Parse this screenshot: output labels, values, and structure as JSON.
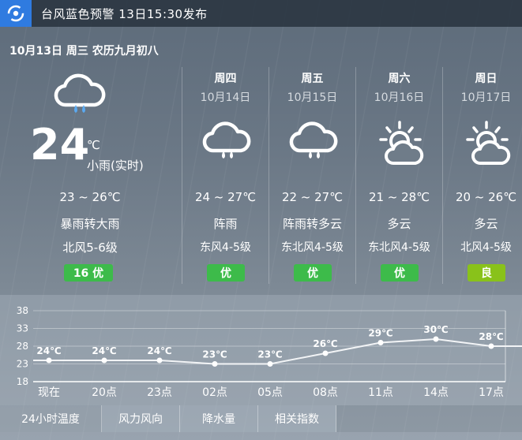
{
  "alert": {
    "icon": "typhoon-icon",
    "text": "台风蓝色预警 13日15:30发布",
    "color": "#2f7be0"
  },
  "date_line": "10月13日 周三 农历九月初八",
  "today": {
    "icon": "cloud-rain-icon",
    "temp": "24",
    "unit": "℃",
    "desc": "小雨(实时)",
    "range": "23 ~ 26℃",
    "condition": "暴雨转大雨",
    "wind": "北风5-6级",
    "aqi": "16 优",
    "aqi_color": "#3dbb4a"
  },
  "days": [
    {
      "week": "周四",
      "date": "10月14日",
      "icon": "cloud-rain-icon",
      "range": "24 ~ 27℃",
      "condition": "阵雨",
      "wind": "东风4-5级",
      "aqi": "优",
      "aqi_color": "#3dbb4a"
    },
    {
      "week": "周五",
      "date": "10月15日",
      "icon": "cloud-rain-icon",
      "range": "22 ~ 27℃",
      "condition": "阵雨转多云",
      "wind": "东北风4-5级",
      "aqi": "优",
      "aqi_color": "#3dbb4a"
    },
    {
      "week": "周六",
      "date": "10月16日",
      "icon": "partly-cloudy-icon",
      "range": "21 ~ 28℃",
      "condition": "多云",
      "wind": "东北风4-5级",
      "aqi": "优",
      "aqi_color": "#3dbb4a"
    },
    {
      "week": "周日",
      "date": "10月17日",
      "icon": "partly-cloudy-icon",
      "range": "20 ~ 26℃",
      "condition": "多云",
      "wind": "北风4-5级",
      "aqi": "良",
      "aqi_color": "#89c21a"
    }
  ],
  "chart_data": {
    "type": "line",
    "categories": [
      "现在",
      "20点",
      "23点",
      "02点",
      "05点",
      "08点",
      "11点",
      "14点",
      "17点"
    ],
    "series": [
      {
        "values": [
          24,
          24,
          24,
          23,
          23,
          26,
          29,
          30,
          28
        ]
      }
    ],
    "data_labels": [
      "24℃",
      "24℃",
      "24℃",
      "23℃",
      "23℃",
      "26℃",
      "29℃",
      "30℃",
      "28℃"
    ],
    "y_ticks": [
      "38",
      "33",
      "28",
      "23",
      "18"
    ],
    "ylim": [
      18,
      38
    ],
    "grid": true
  },
  "tabs": [
    "24小时温度",
    "风力风向",
    "降水量",
    "相关指数"
  ]
}
